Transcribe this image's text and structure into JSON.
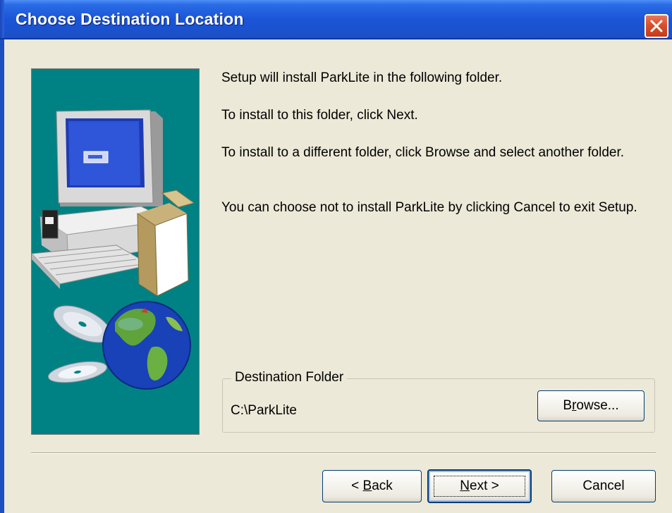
{
  "window": {
    "title": "Choose Destination Location",
    "titlebar_color": "#1b55d6",
    "close_icon": "close-icon"
  },
  "content": {
    "line1": "Setup will install ParkLite in the following folder.",
    "line2": "To install to this folder, click Next.",
    "line3": "To install to a different folder, click Browse and select another folder.",
    "line4": "You can choose not to install ParkLite by clicking Cancel to exit Setup."
  },
  "destination": {
    "group_label": "Destination Folder",
    "path": "C:\\ParkLite",
    "browse_prefix": "B",
    "browse_accel": "r",
    "browse_suffix": "owse..."
  },
  "buttons": {
    "back_prefix": "< ",
    "back_accel": "B",
    "back_suffix": "ack",
    "next_accel": "N",
    "next_suffix": "ext >",
    "cancel": "Cancel"
  },
  "side_image": {
    "icon": "setup-computer-globe-illustration",
    "background": "#008284"
  }
}
